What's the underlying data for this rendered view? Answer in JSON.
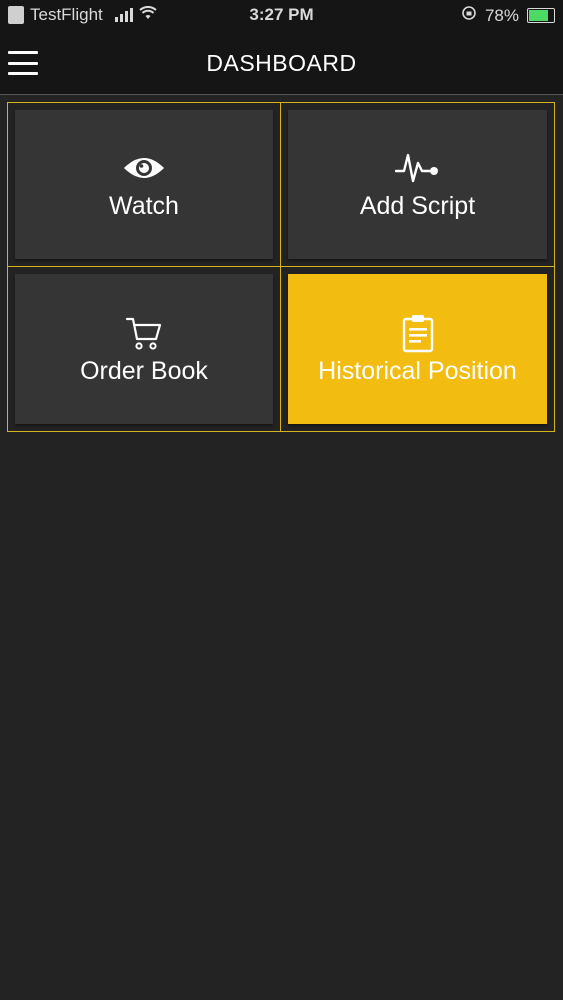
{
  "status_bar": {
    "carrier": "TestFlight",
    "time": "3:27 PM",
    "battery": "78%",
    "battery_level": 0.78,
    "battery_color": "#4cd964"
  },
  "nav": {
    "title": "DASHBOARD",
    "menu_icon": "hamburger-menu-icon"
  },
  "tiles": [
    {
      "label": "Watch",
      "icon": "eye-icon",
      "active": false
    },
    {
      "label": "Add Script",
      "icon": "pulse-icon",
      "active": false
    },
    {
      "label": "Order Book",
      "icon": "cart-icon",
      "active": false
    },
    {
      "label": "Historical Position",
      "icon": "clipboard-icon",
      "active": true
    }
  ],
  "colors": {
    "accent": "#f2bc10",
    "grid_border": "#d4b520",
    "tile_bg": "#353535",
    "background": "#232323"
  }
}
